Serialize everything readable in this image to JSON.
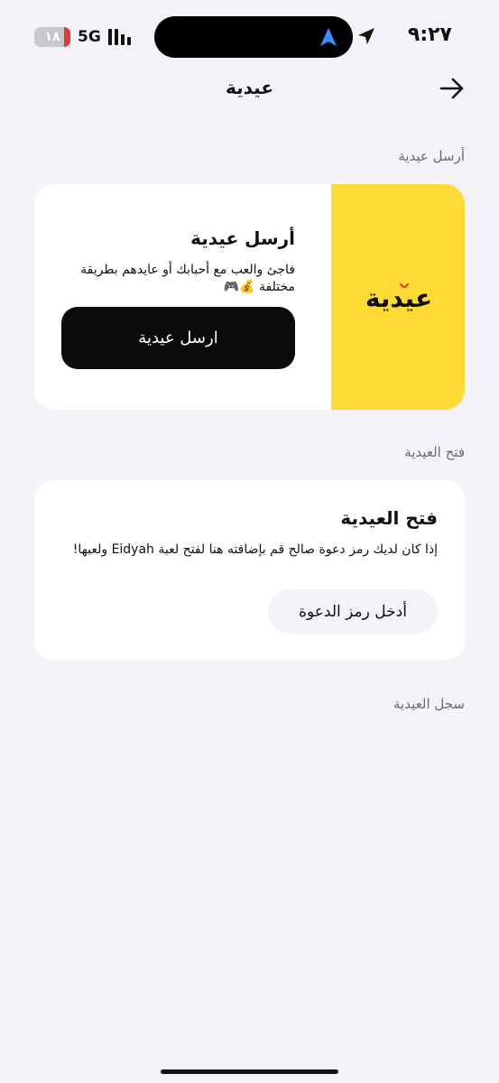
{
  "status_bar": {
    "time": "٩:٢٧",
    "network": "5G",
    "battery": "١٨",
    "battery_level": 0.18,
    "battery_color": "#e5372f",
    "location_icon": "location-arrow-icon",
    "navigation_icon": "navigation-arrow-icon"
  },
  "nav": {
    "title": "عيدية",
    "back_icon": "arrow-right-icon"
  },
  "send_section": {
    "label": "أرسل عيدية",
    "card_title": "أرسل عيدية",
    "description": "فاجئ والعب مع أحبابك أو عايدهم بطريقة مختلفة 💰🎮",
    "button_label": "ارسل عيدية",
    "brand_logo": "عيدية",
    "brand_color": "#ffda35"
  },
  "open_section": {
    "label": "فتح العيدية",
    "card_title": "فتح العيدية",
    "description": "إذا كان لديك رمز دعوة صالح قم بإضافته هنا لفتح لعبة Eidyah ولعبها!",
    "button_label": "أدخل رمز الدعوة"
  },
  "history_section": {
    "label": "سجل العيدية"
  }
}
